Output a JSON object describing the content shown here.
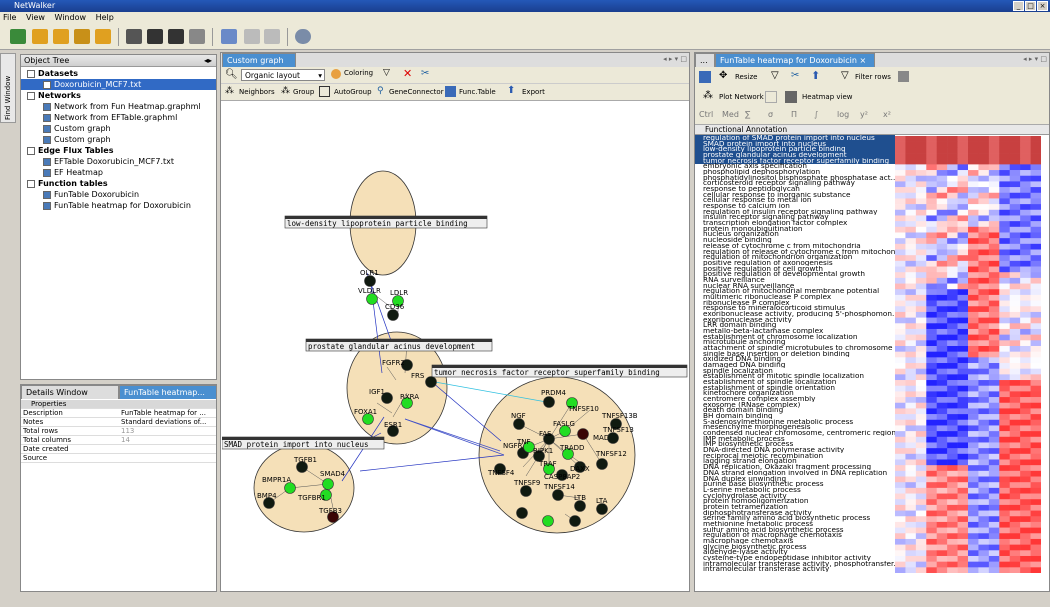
{
  "window": {
    "title": "NetWalker"
  },
  "menu": [
    "File",
    "View",
    "Window",
    "Help"
  ],
  "object_tree": {
    "title": "Object Tree",
    "side_tab": "Find Window",
    "items": [
      {
        "label": "Datasets",
        "bold": true,
        "level": 0
      },
      {
        "label": "Doxorubicin_MCF7.txt",
        "bold": false,
        "level": 1,
        "selected": true
      },
      {
        "label": "Networks",
        "bold": true,
        "level": 0
      },
      {
        "label": "Network from Fun Heatmap.graphml",
        "bold": false,
        "level": 1
      },
      {
        "label": "Network from EFTable.graphml",
        "bold": false,
        "level": 1
      },
      {
        "label": "Custom graph",
        "bold": false,
        "level": 1
      },
      {
        "label": "Custom graph",
        "bold": false,
        "level": 1
      },
      {
        "label": "Edge Flux Tables",
        "bold": true,
        "level": 0
      },
      {
        "label": "EFTable Doxorubicin_MCF7.txt",
        "bold": false,
        "level": 1
      },
      {
        "label": "EF Heatmap",
        "bold": false,
        "level": 1
      },
      {
        "label": "Function tables",
        "bold": true,
        "level": 0
      },
      {
        "label": "FunTable Doxorubicin",
        "bold": false,
        "level": 1
      },
      {
        "label": "FunTable heatmap for Doxorubicin",
        "bold": false,
        "level": 1
      }
    ]
  },
  "details": {
    "tabs": [
      "Details Window",
      "FunTable heatmap..."
    ],
    "section": "Properties",
    "rows": [
      {
        "key": "Description",
        "value": "FunTable heatmap for ...",
        "gray": false
      },
      {
        "key": "Notes",
        "value": "Standard deviations of...",
        "gray": false
      },
      {
        "key": "Total rows",
        "value": "113",
        "gray": true
      },
      {
        "key": "Total columns",
        "value": "14",
        "gray": true
      },
      {
        "key": "Date created",
        "value": "",
        "gray": false
      },
      {
        "key": "Source",
        "value": "",
        "gray": false
      }
    ]
  },
  "graph": {
    "tab": "Custom graph",
    "layout_select": "Organic layout",
    "buttons": {
      "coloring": "Coloring",
      "neighbors": "Neighbors",
      "group": "Group",
      "autogroup": "AutoGroup",
      "geneconnector": "GeneConnector",
      "functable": "Func.Table",
      "export": "Export"
    },
    "group_labels": {
      "ldl": "low-density lipoprotein particle binding",
      "prostate": "prostate glandular acinus development",
      "tnf": "tumor necrosis factor receptor superfamily binding",
      "smad": "SMAD protein import into nucleus"
    },
    "nodes": {
      "olr1": "OLR1",
      "ldlr": "LDLR",
      "vldlr": "VLDLR",
      "cd36": "CD36",
      "fgfr2": "FGFR2",
      "igf1": "IGF1",
      "rxra": "RXRA",
      "foxa1": "FOXA1",
      "esr1": "ESR1",
      "frs": "FRS",
      "tgfb1": "TGFB1",
      "bmpr1a": "BMPR1A",
      "smad4": "SMAD4",
      "tgfbr1": "TGFBR1",
      "bmp4": "BMP4",
      "tgfb3": "TGFB3",
      "ngf": "NGF",
      "prdm4": "PRDM4",
      "ngfrap": "NGFRAP",
      "tnfsf10": "TNFSF10",
      "tnfsf13b": "TNFSF13B",
      "tnfsf13": "TNFSF13",
      "madd": "MADD",
      "tnf": "TNF",
      "ripk1": "RIPK1",
      "fadd": "FADD",
      "traf": "TRAF",
      "daxx": "DAXX",
      "tnfsf12": "TNFSF12",
      "tnfsf4": "TNFSF4",
      "tnfsf9": "TNFSF9",
      "tnfsf14": "TNFSF14",
      "ltb": "LTB",
      "lta": "LTA",
      "fas": "FAS",
      "faslg": "FASLG",
      "tradd": "TRADD",
      "casp8ap2": "CASP8AP2"
    }
  },
  "heatmap": {
    "tab": "FunTable heatmap for Doxorubicin",
    "buttons": {
      "resize": "Resize",
      "filter_rows": "Filter rows",
      "plot_network": "Plot Network",
      "heatmap_view": "Heatmap view"
    },
    "math_buttons": [
      "Ctrl",
      "Med",
      "∑",
      "σ",
      "Π",
      "∫",
      "log",
      "y²",
      "x²"
    ],
    "column_header": "Functional Annotation",
    "annotations": [
      "regulation of SMAD protein import into nucleus",
      "SMAD protein import into nucleus",
      "low-density lipoprotein particle binding",
      "prostate glandular acinus development",
      "tumor necrosis factor receptor superfamily binding",
      "embryonic axis specification",
      "phospholipid dephosphorylation",
      "phosphatidylinositol bisphosphate phosphatase act...",
      "corticosteroid receptor signaling pathway",
      "response to peptidoglycan",
      "cellular response to inorganic substance",
      "cellular response to metal ion",
      "response to calcium ion",
      "regulation of insulin receptor signaling pathway",
      "insulin receptor signaling pathway",
      "transcription elongation factor complex",
      "protein monoubiquitination",
      "nucleus organization",
      "nucleoside binding",
      "release of cytochrome c from mitochondria",
      "regulation of release of cytochrome c from mitochon...",
      "regulation of mitochondrion organization",
      "positive regulation of axonogenesis",
      "positive regulation of cell growth",
      "positive regulation of developmental growth",
      "RNA surveillance",
      "nuclear RNA surveillance",
      "regulation of mitochondrial membrane potential",
      "multimeric ribonuclease P complex",
      "ribonuclease P complex",
      "response to mineralocorticoid stimulus",
      "exoribonuclease activity, producing 5'-phosphomon...",
      "exoribonuclease activity",
      "LRR domain binding",
      "metallo-beta-lactamase complex",
      "establishment of chromosome localization",
      "microtubule anchoring",
      "attachment of spindle microtubules to chromosome",
      "single base insertion or deletion binding",
      "oxidized DNA binding",
      "damaged DNA binding",
      "spindle localization",
      "establishment of mitotic spindle localization",
      "establishment of spindle localization",
      "establishment of spindle orientation",
      "kinetochore organization",
      "centromere complex assembly",
      "exosome (RNase complex)",
      "death domain binding",
      "BH domain binding",
      "S-adenosylmethionine metabolic process",
      "mesenchyme morphogenesis",
      "condensed nuclear chromosome, centromeric region",
      "IMP metabolic process",
      "IMP biosynthetic process",
      "DNA-directed DNA polymerase activity",
      "reciprocal meiotic recombination",
      "lagging strand elongation",
      "DNA replication, Okazaki fragment processing",
      "DNA strand elongation involved in DNA replication",
      "DNA duplex unwinding",
      "purine base biosynthetic process",
      "L-serine metabolic process",
      "cyclohydrolase activity",
      "protein homooligomerization",
      "protein tetramerization",
      "diphosphotransferase activity",
      "serine family amino acid biosynthetic process",
      "methionine metabolic process",
      "sulfur amino acid biosynthetic process",
      "regulation of macrophage chemotaxis",
      "macrophage chemotaxis",
      "glycine biosynthetic process",
      "aldehyde-lyase activity",
      "cysteine-type endopeptidase inhibitor activity",
      "intramolecular transferase activity, phosphotransfer...",
      "intramolecular transferase activity"
    ]
  },
  "colors": {
    "titlebar": "#1a3f8f",
    "tab_active": "#4a8fd0",
    "group_fill": "#f5e0b8",
    "node_green": "#22dd22",
    "node_dark": "#101a10",
    "node_darkred": "#3a0505"
  }
}
